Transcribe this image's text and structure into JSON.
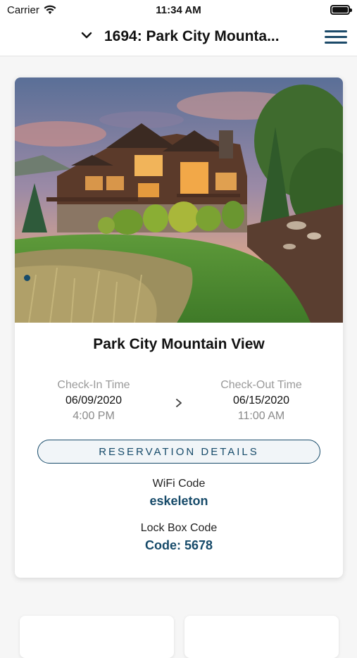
{
  "status_bar": {
    "carrier": "Carrier",
    "time": "11:34 AM"
  },
  "nav": {
    "title": "1694: Park City Mounta..."
  },
  "reservation": {
    "property_name": "Park City Mountain View",
    "check_in": {
      "label": "Check-In Time",
      "date": "06/09/2020",
      "time": "4:00 PM"
    },
    "check_out": {
      "label": "Check-Out Time",
      "date": "06/15/2020",
      "time": "11:00 AM"
    },
    "details_button": "RESERVATION DETAILS",
    "wifi": {
      "label": "WiFi Code",
      "value": "eskeleton"
    },
    "lockbox": {
      "label": "Lock Box Code",
      "value": "Code: 5678"
    }
  },
  "colors": {
    "accent": "#174b6a",
    "menu": "#1c4a69"
  }
}
